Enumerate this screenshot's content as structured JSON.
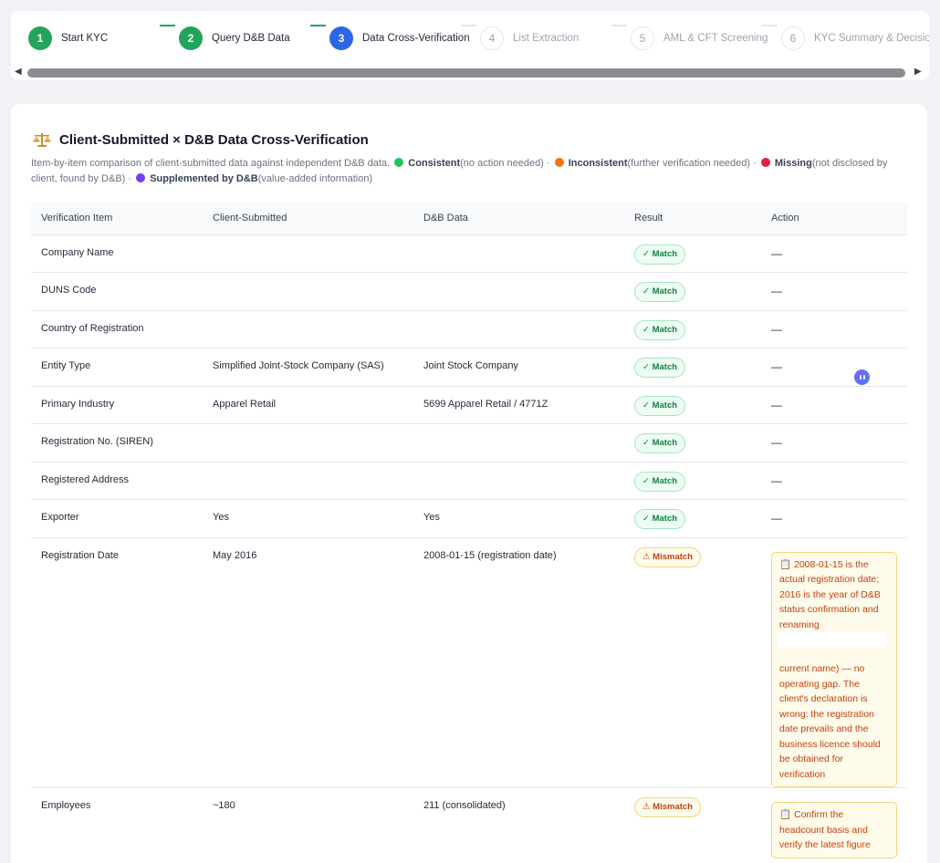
{
  "stepper": {
    "steps": [
      {
        "number": "1",
        "label": "Start KYC",
        "status": "done"
      },
      {
        "number": "2",
        "label": "Query D&B Data",
        "status": "done"
      },
      {
        "number": "3",
        "label": "Data Cross-Verification",
        "status": "active"
      },
      {
        "number": "4",
        "label": "List Extraction",
        "status": "pending"
      },
      {
        "number": "5",
        "label": "AML & CFT Screening",
        "status": "pending"
      },
      {
        "number": "6",
        "label": "KYC Summary & Decision",
        "status": "pending"
      }
    ]
  },
  "section": {
    "title": "Client-Submitted × D&B Data Cross-Verification",
    "intro": "Item-by-item comparison of client-submitted data against independent D&B data.",
    "legend": [
      {
        "label": "Consistent",
        "desc": "(no action needed)",
        "color": "#22c55e"
      },
      {
        "label": "Inconsistent",
        "desc": "(further verification needed)",
        "color": "#f97316"
      },
      {
        "label": "Missing",
        "desc": "(not disclosed by client, found by D&B)",
        "color": "#e11d48"
      },
      {
        "label": "Supplemented by D&B",
        "desc": "(value-added information)",
        "color": "#7c3aed"
      }
    ]
  },
  "table": {
    "headers": [
      "Verification Item",
      "Client-Submitted",
      "D&B Data",
      "Result",
      "Action"
    ],
    "rows": [
      {
        "item": "Company Name",
        "client": "",
        "dnb": "",
        "result": "✓ Match",
        "status": "match",
        "action": "—"
      },
      {
        "item": "DUNS Code",
        "client": "",
        "dnb": "",
        "result": "✓ Match",
        "status": "match",
        "action": "—"
      },
      {
        "item": "Country of Registration",
        "client": "",
        "dnb": "",
        "result": "✓ Match",
        "status": "match",
        "action": "—"
      },
      {
        "item": "Entity Type",
        "client": "Simplified Joint-Stock Company (SAS)",
        "dnb": "Joint Stock Company",
        "result": "✓ Match",
        "status": "match",
        "action": "—"
      },
      {
        "item": "Primary Industry",
        "client": "Apparel Retail",
        "dnb": "5699 Apparel Retail / 4771Z",
        "result": "✓ Match",
        "status": "match",
        "action": "—"
      },
      {
        "item": "Registration No. (SIREN)",
        "client": "",
        "dnb": "",
        "result": "✓ Match",
        "status": "match",
        "action": "—"
      },
      {
        "item": "Registered Address",
        "client": "",
        "dnb": "",
        "result": "✓ Match",
        "status": "match",
        "action": "—"
      },
      {
        "item": "Exporter",
        "client": "Yes",
        "dnb": "Yes",
        "result": "✓ Match",
        "status": "match",
        "action": "—"
      },
      {
        "item": "Registration Date",
        "client": "May 2016",
        "dnb": "2008-01-15 (registration date)",
        "result": "⚠ Mismatch",
        "status": "mismatch",
        "note_part1": "📋 2008-01-15 is the actual registration date; 2016 is the year of D&B status confirmation and renaming",
        "note_part2": "current name) — no operating gap. The client's declaration is wrong: the registration date prevails and the business licence should be obtained for verification"
      },
      {
        "item": "Employees",
        "client": "~180",
        "dnb": "211 (consolidated)",
        "result": "⚠ Mismatch",
        "status": "mismatch",
        "note_part1": "📋 Confirm the headcount basis and verify the latest figure",
        "note_part2": ""
      }
    ]
  }
}
